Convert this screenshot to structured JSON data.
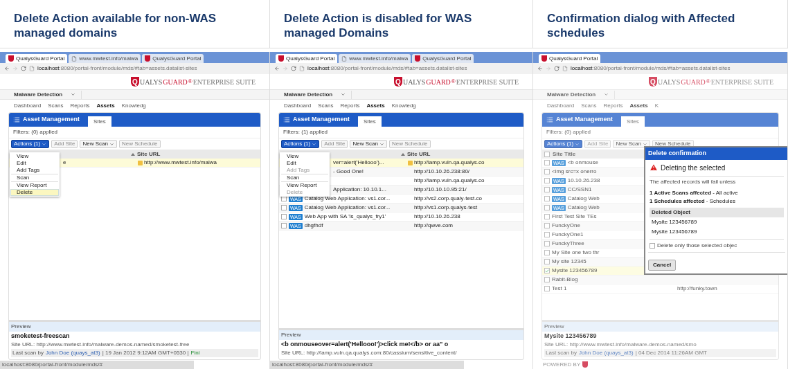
{
  "panels": [
    {
      "heading": "Delete Action available for non-WAS managed domains",
      "dimmed": false,
      "tabs": [
        {
          "title": "QualysGuard Portal",
          "selected": true,
          "kind": "portal"
        },
        {
          "title": "www.mwtest.info/malwa",
          "selected": false,
          "kind": "page"
        },
        {
          "title": "QualysGuard Portal",
          "selected": false,
          "kind": "portal"
        }
      ],
      "url_host": "localhost",
      "url_path": ":8080/portal-front/module/mds/#tab=assets.datalist-sites",
      "logo": {
        "mark": "Q",
        "name_a": "UALYS",
        "name_b": "GUARD",
        "reg": "®",
        "suite": "ENTERPRISE SUITE"
      },
      "module": "Malware Detection",
      "nav": [
        {
          "label": "Dashboard",
          "selected": false
        },
        {
          "label": "Scans",
          "selected": false
        },
        {
          "label": "Reports",
          "selected": false
        },
        {
          "label": "Assets",
          "selected": true
        },
        {
          "label": "Knowledg",
          "selected": false
        }
      ],
      "card": {
        "title": "Asset Management",
        "tab": "Sites",
        "filters": "Filters: (0) applied",
        "toolbar": [
          {
            "label": "Actions (1)",
            "kind": "primary",
            "disabled": false
          },
          {
            "label": "Add Site",
            "kind": "plain",
            "disabled": true
          },
          {
            "label": "New Scan",
            "kind": "dropdown",
            "disabled": false
          },
          {
            "label": "New Schedule",
            "kind": "plain",
            "disabled": true
          }
        ],
        "url_column": "Site URL",
        "rows": [
          {
            "kind": "partly-hidden",
            "title": "e",
            "url": "http://www.mwtest.info/malwa",
            "selected": true,
            "tagged": true
          }
        ],
        "menu": [
          {
            "kind": "item",
            "label": "View",
            "disabled": false,
            "selected": false
          },
          {
            "kind": "item",
            "label": "Edit",
            "disabled": false,
            "selected": false
          },
          {
            "kind": "item",
            "label": "Add Tags",
            "disabled": false,
            "selected": false
          },
          {
            "kind": "separator"
          },
          {
            "kind": "item",
            "label": "Scan",
            "disabled": false,
            "selected": false
          },
          {
            "kind": "separator"
          },
          {
            "kind": "item",
            "label": "View Report",
            "disabled": false,
            "selected": false
          },
          {
            "kind": "item",
            "label": "Delete",
            "disabled": false,
            "selected": true
          }
        ],
        "preview": {
          "heading": "Preview",
          "title": "smoketest-freescan",
          "site_url_label": "Site URL:",
          "site_url": "http://www.mwtest.info/malware-demos-named/smoketest-free",
          "last_scan": "Last scan by",
          "user": "John Doe (quays_at3)",
          "details": "| 19 Jan 2012 9:12AM GMT+0530 |",
          "status": "Fini"
        }
      },
      "status_url": "localhost:8080/portal-front/module/mds/#"
    },
    {
      "heading": "Delete Action is disabled for WAS managed Domains",
      "dimmed": false,
      "tabs": [
        {
          "title": "QualysGuard Portal",
          "selected": true,
          "kind": "portal"
        },
        {
          "title": "www.mwtest.info/malwa",
          "selected": false,
          "kind": "page"
        },
        {
          "title": "QualysGuard Portal",
          "selected": false,
          "kind": "portal"
        }
      ],
      "url_host": "localhost",
      "url_path": ":8080/portal-front/module/mds/#tab=assets.datalist-sites",
      "logo": {
        "mark": "Q",
        "name_a": "UALYS",
        "name_b": "GUARD",
        "reg": "®",
        "suite": "ENTERPRISE SUITE"
      },
      "module": "Malware Detection",
      "nav": [
        {
          "label": "Dashboard",
          "selected": false
        },
        {
          "label": "Scans",
          "selected": false
        },
        {
          "label": "Reports",
          "selected": false
        },
        {
          "label": "Assets",
          "selected": true
        },
        {
          "label": "Knowledg",
          "selected": false
        }
      ],
      "card": {
        "title": "Asset Management",
        "tab": "Sites",
        "filters": "Filters: (1) applied",
        "toolbar": [
          {
            "label": "Actions (1)",
            "kind": "primary",
            "disabled": false
          },
          {
            "label": "Add Site",
            "kind": "plain",
            "disabled": true
          },
          {
            "label": "New Scan",
            "kind": "dropdown",
            "disabled": false
          },
          {
            "label": "New Schedule",
            "kind": "plain",
            "disabled": true
          }
        ],
        "url_column": "Site URL",
        "rows": [
          {
            "kind": "partly-hidden",
            "title": "ver=alert('Hellooo')...",
            "url": "http://lamp.vuln.qa.qualys.co",
            "selected": true,
            "tagged": true
          },
          {
            "kind": "partly-hidden",
            "title": "- Good One!",
            "url": "http://10.10.26.238:80/",
            "selected": false,
            "tagged": false
          },
          {
            "kind": "partly-hidden",
            "title": "",
            "url": "http://lamp.vuln.qa.qualys.co",
            "selected": false,
            "tagged": false
          },
          {
            "kind": "partly-hidden",
            "title": "Application: 10.10.1...",
            "url": "http://10.10.10.95:21/",
            "selected": false,
            "tagged": false
          },
          {
            "kind": "full",
            "badge": "WAS",
            "title": "Catalog Web Application: vs1.cor...",
            "url": "http://vs2.corp.qualy-test.co",
            "selected": false,
            "checked": false,
            "tagged": false
          },
          {
            "kind": "full",
            "badge": "WAS",
            "title": "Catalog Web Application: vs1.cor...",
            "url": "http://vs1.corp.qualys-test",
            "selected": false,
            "checked": false,
            "tagged": false
          },
          {
            "kind": "full",
            "badge": "WAS",
            "title": "Web App with SA 'ls_qualys_fry1'",
            "url": "http://10.10.26.238",
            "selected": false,
            "checked": false,
            "tagged": false
          },
          {
            "kind": "full",
            "badge": "WAS",
            "title": "dhgfhdf",
            "url": "http://qwve.com",
            "selected": false,
            "checked": false,
            "tagged": false
          }
        ],
        "menu": [
          {
            "kind": "item",
            "label": "View",
            "disabled": false,
            "selected": false
          },
          {
            "kind": "item",
            "label": "Edit",
            "disabled": false,
            "selected": false
          },
          {
            "kind": "item",
            "label": "Add Tags",
            "disabled": true,
            "selected": false
          },
          {
            "kind": "separator"
          },
          {
            "kind": "item",
            "label": "Scan",
            "disabled": false,
            "selected": false
          },
          {
            "kind": "separator"
          },
          {
            "kind": "item",
            "label": "View Report",
            "disabled": false,
            "selected": false
          },
          {
            "kind": "item",
            "label": "Delete",
            "disabled": true,
            "selected": false
          }
        ],
        "preview": {
          "heading": "Preview",
          "title": "<b onmouseover=alert('Hellooo!')>click me!</b> or aa\" o",
          "site_url_label": "Site URL:",
          "site_url": "http://lamp.vuln.qa.qualys.com:80/cassium/sensitive_content/"
        }
      },
      "status_url": "localhost:8080/portal-front/module/mds/#"
    },
    {
      "heading": "Confirmation dialog with Affected schedules",
      "dimmed": true,
      "tabs": [
        {
          "title": "QualysGuard Portal",
          "selected": true,
          "kind": "portal"
        }
      ],
      "url_host": "localhost",
      "url_path": ":8080/portal-front/module/mds/#tab=assets.datalist-sites",
      "logo": {
        "mark": "Q",
        "name_a": "UALYS",
        "name_b": "GUARD",
        "reg": "®",
        "suite": "ENTERPRISE SUITE"
      },
      "module": "Malware Detection",
      "nav": [
        {
          "label": "Dashboard",
          "selected": false
        },
        {
          "label": "Scans",
          "selected": false
        },
        {
          "label": "Reports",
          "selected": false
        },
        {
          "label": "Assets",
          "selected": true
        },
        {
          "label": "K",
          "selected": false
        }
      ],
      "card": {
        "title": "Asset Management",
        "tab": "Sites",
        "filters": "Filters: (0) applied",
        "toolbar": [
          {
            "label": "Actions (1)",
            "kind": "primary",
            "disabled": false
          },
          {
            "label": "Add Site",
            "kind": "plain",
            "disabled": true
          },
          {
            "label": "New Scan",
            "kind": "dropdown",
            "disabled": false
          },
          {
            "label": "New Schedule",
            "kind": "plain",
            "disabled": false
          }
        ],
        "title_column": "Site Title",
        "header_checked": false,
        "rows": [
          {
            "kind": "full",
            "badge": "WAS",
            "title": "<b onmouse",
            "selected": false,
            "checked": false
          },
          {
            "kind": "full",
            "title": "<img src=x onerro",
            "selected": false,
            "checked": false
          },
          {
            "kind": "full",
            "badge": "WAS",
            "title": "10.10.26.238",
            "selected": false,
            "checked": false
          },
          {
            "kind": "full",
            "badge": "WAS",
            "title": "CC/SSN1",
            "selected": false,
            "checked": false
          },
          {
            "kind": "full",
            "badge": "WAS",
            "title": "Catalog Web",
            "selected": false,
            "checked": false
          },
          {
            "kind": "full",
            "badge": "WAS",
            "title": "Catalog Web",
            "selected": false,
            "checked": false
          },
          {
            "kind": "full",
            "title": "First Test Site TEs",
            "selected": false,
            "checked": false
          },
          {
            "kind": "full",
            "title": "FunckyOne",
            "selected": false,
            "checked": false
          },
          {
            "kind": "full",
            "title": "FunckyOne1",
            "selected": false,
            "checked": false
          },
          {
            "kind": "full",
            "title": "FunckyThree",
            "selected": false,
            "checked": false
          },
          {
            "kind": "full",
            "title": "My Site one two thr",
            "selected": false,
            "checked": false
          },
          {
            "kind": "full",
            "title": "My site 12345",
            "selected": false,
            "checked": false
          },
          {
            "kind": "full",
            "title": "Mysite 123456789",
            "selected": true,
            "checked": true
          },
          {
            "kind": "full",
            "title": "Rabit-Blog",
            "selected": false,
            "checked": false
          },
          {
            "kind": "full",
            "title": "Test 1",
            "url": "http://funky.town",
            "selected": false,
            "checked": false
          }
        ],
        "preview": {
          "heading": "Preview",
          "title": "Mysite 123456789",
          "site_url_label": "Site URL:",
          "site_url": "http://www.mwtest.info/malware-demos-named/smo",
          "last_scan": "Last scan by",
          "user": "John Doe (quays_at3)",
          "details": "| 04 Dec 2014 11:26AM GMT"
        }
      },
      "footer": "POWERED BY",
      "dialog": {
        "title": "Delete confirmation",
        "warning": "Deleting the selected",
        "note": "The affected records will fail unless",
        "impacts": [
          "**1 Active Scans affected** - All active",
          "**1 Schedules affected** - Schedules"
        ],
        "column": "Deleted Object",
        "objects": [
          "Mysite 123456789",
          "Mysite 123456789"
        ],
        "option": {
          "label": "Delete only those selected objec",
          "checked": false
        },
        "button": "Cancel"
      }
    }
  ]
}
